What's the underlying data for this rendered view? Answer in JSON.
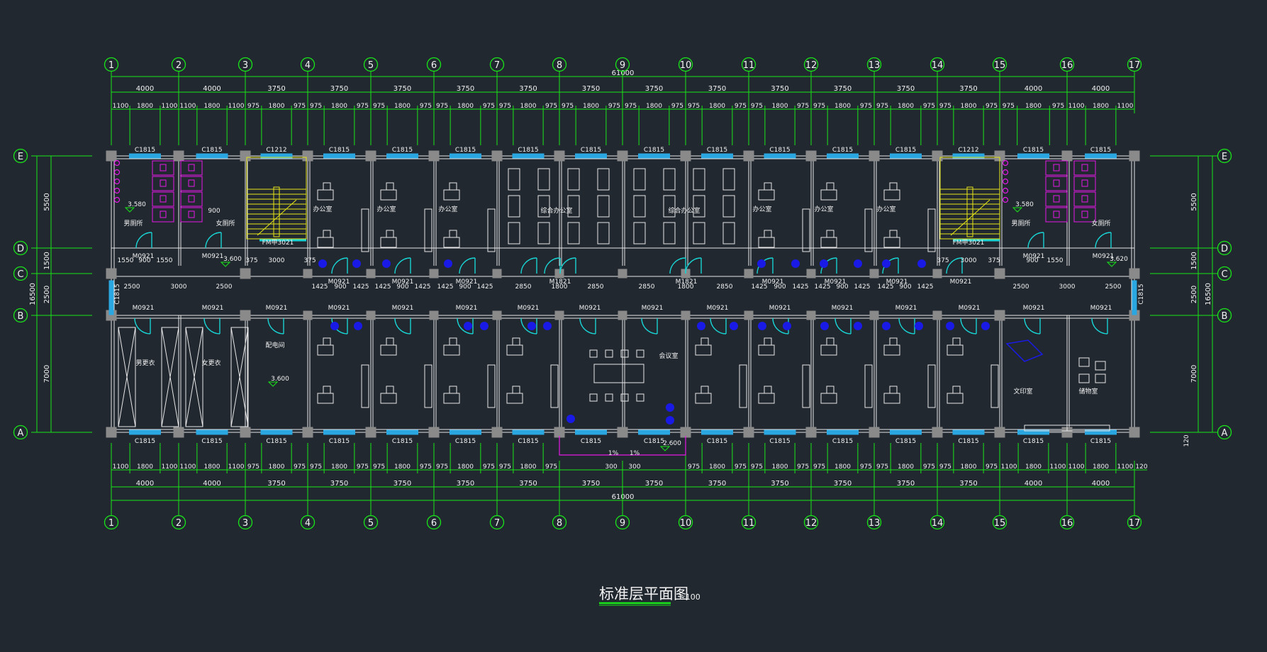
{
  "colors": {
    "background": "#212830",
    "dim_line": "#19e619",
    "dim_text": "#f2f2f2",
    "wall": "#e6e6e6",
    "column": "#8a8a8a",
    "door": "#19d2d2",
    "window": "#2aa7e0",
    "stair": "#e6e619",
    "fixture": "#e619e6",
    "plant": "#1a1ae6"
  },
  "title": {
    "text": "标准层平面图",
    "scale": "1:100"
  },
  "grid": {
    "x_labels": [
      "1",
      "2",
      "3",
      "4",
      "5",
      "6",
      "7",
      "8",
      "9",
      "10",
      "11",
      "12",
      "13",
      "14",
      "15",
      "16",
      "17"
    ],
    "y_labels": [
      "E",
      "D",
      "C",
      "B",
      "A"
    ],
    "x_dims": [
      "4000",
      "4000",
      "3750",
      "3750",
      "3750",
      "3750",
      "3750",
      "3750",
      "3750",
      "3750",
      "3750",
      "3750",
      "3750",
      "3750",
      "4000",
      "4000"
    ],
    "total_length": "61000",
    "top_sub_dims": [
      "1100",
      "1800",
      "1100",
      "1100",
      "1800",
      "1100",
      "975",
      "1800",
      "975",
      "975",
      "1800",
      "975",
      "975",
      "1800",
      "975",
      "975",
      "1800",
      "975",
      "975",
      "1800",
      "975",
      "975",
      "1800",
      "975",
      "975",
      "1800",
      "975",
      "975",
      "1800",
      "975",
      "975",
      "1800",
      "975",
      "975",
      "1800",
      "975",
      "975",
      "1800",
      "975",
      "975",
      "1800",
      "975",
      "975",
      "1800",
      "975",
      "1100",
      "1800",
      "1100",
      "1100",
      "1800",
      "1100"
    ],
    "bottom_sub_left": [
      "1100",
      "1800",
      "1100",
      "1100",
      "1800",
      "1100",
      "975",
      "1800",
      "975",
      "975",
      "1800",
      "975",
      "975",
      "1800",
      "975",
      "975",
      "1800",
      "975",
      "975",
      "1800",
      "975"
    ],
    "bottom_sub_center": [
      "300",
      "300"
    ],
    "bottom_sub_right": [
      "975",
      "1800",
      "975",
      "975",
      "1800",
      "975",
      "975",
      "1800",
      "975",
      "975",
      "1800",
      "975",
      "975",
      "1800",
      "975",
      "1100",
      "1800",
      "1100",
      "1100",
      "1800",
      "1100"
    ],
    "right_extra": "120",
    "y_dims": [
      "5500",
      "1500",
      "2500",
      "7000"
    ],
    "total_depth": "16500"
  },
  "labels": {
    "top_windows": [
      "C1815",
      "C1815",
      "C1212",
      "C1815",
      "C1815",
      "C1815",
      "C1815",
      "C1815",
      "C1815",
      "C1815",
      "C1815",
      "C1815",
      "C1815",
      "C1212",
      "C1815",
      "C1815"
    ],
    "bottom_windows": [
      "C1815",
      "C1815",
      "C1815",
      "C1815",
      "C1815",
      "C1815",
      "C1815",
      "C1815",
      "C1815",
      "C1815",
      "C1815",
      "C1815",
      "C1815",
      "C1815",
      "C1815",
      "C1815"
    ],
    "side_window": "C1815",
    "rooms_top": [
      "男厕所",
      "女厕所",
      "办公室",
      "办公室",
      "办公室",
      "综合办公室",
      "综合办公室",
      "办公室",
      "办公室",
      "办公室",
      "男厕所",
      "女厕所"
    ],
    "rooms_bottom": [
      "男更衣",
      "女更衣",
      "配电间",
      "会议室",
      "文印室",
      "储物室"
    ],
    "doors_top": [
      "M0921",
      "M0921",
      "FM甲3021",
      "M0921",
      "M0921",
      "M0921",
      "M1821",
      "M1821",
      "M0921",
      "M0921",
      "M0921",
      "M0921",
      "FM甲3021",
      "M0921",
      "M0921"
    ],
    "doors_bottom": [
      "M0921",
      "M0921",
      "M0921",
      "M0921",
      "M0921",
      "M0921",
      "M0921",
      "M0921",
      "M0921",
      "M0921",
      "M0921",
      "M0921",
      "M0921",
      "M0921",
      "M0921",
      "M0921"
    ],
    "corridor_dims_left": [
      "1550",
      "900",
      "1550",
      "375",
      "3000",
      "375"
    ],
    "corridor_dims_mid": [
      "2500",
      "3000",
      "2500",
      "1425",
      "900",
      "1425",
      "1425",
      "900",
      "1425",
      "1425",
      "900",
      "1425",
      "2850",
      "1800",
      "2850",
      "2850",
      "1800",
      "2850",
      "1425",
      "900",
      "1425",
      "1425",
      "900",
      "1425",
      "1425",
      "900",
      "1425"
    ],
    "corridor_dims_right": [
      "375",
      "3000",
      "375",
      "900",
      "1550",
      "2500",
      "3000",
      "2500"
    ],
    "elevations": [
      "3.580",
      "3.600",
      "3.600",
      "3.580",
      "3.620",
      "2.600",
      "900",
      "1%",
      "1%"
    ]
  }
}
